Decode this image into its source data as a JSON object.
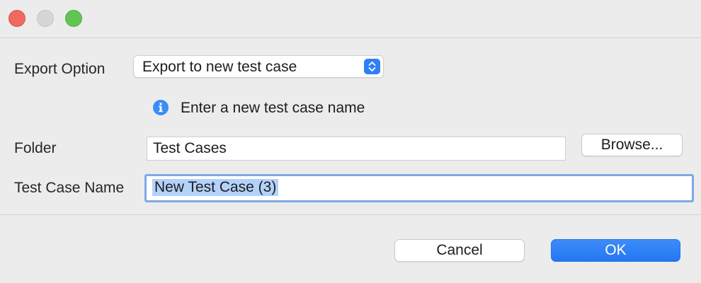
{
  "window": {
    "traffic_lights": [
      "close",
      "minimize",
      "zoom"
    ],
    "colors": {
      "close": "#ee6a5f",
      "minimize": "#d6d6d6",
      "zoom": "#61c554"
    }
  },
  "form": {
    "export_option_label": "Export Option",
    "export_option_value": "Export to new test case",
    "info_icon": "info-icon",
    "info_message": "Enter a new test case name",
    "folder_label": "Folder",
    "folder_value": "Test Cases",
    "browse_label": "Browse...",
    "test_case_name_label": "Test Case Name",
    "test_case_name_value": "New Test Case (3)"
  },
  "footer": {
    "cancel_label": "Cancel",
    "ok_label": "OK"
  },
  "colors": {
    "accent": "#2f7ff6",
    "selection": "#b3d2fb",
    "focus_ring": "#7fa9e6"
  }
}
